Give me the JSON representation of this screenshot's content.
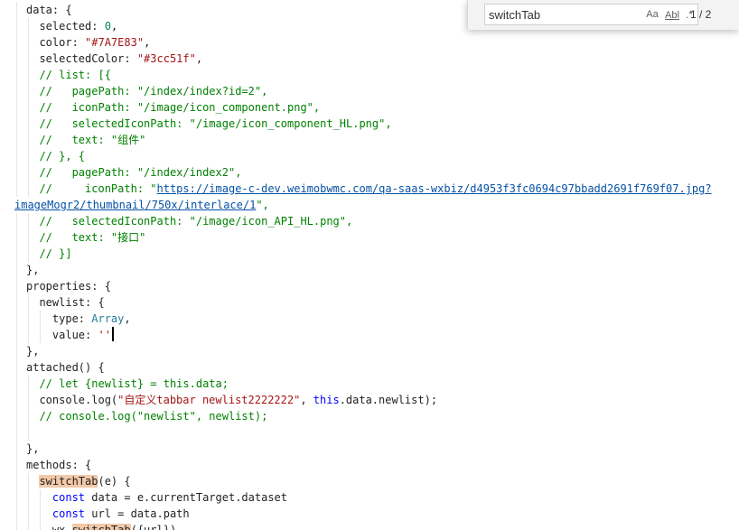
{
  "find": {
    "query": "switchTab",
    "case_label": "Aa",
    "word_label": "Abl",
    "regex_label": ".*",
    "count": "1 / 2"
  },
  "code": [
    {
      "guides": [
        18
      ],
      "segs": [
        [
          "plain",
          "data: {"
        ]
      ]
    },
    {
      "guides": [
        18,
        31
      ],
      "segs": [
        [
          "plain",
          "  selected: "
        ],
        [
          "num",
          "0"
        ],
        [
          "plain",
          ","
        ]
      ]
    },
    {
      "guides": [
        18,
        31
      ],
      "segs": [
        [
          "plain",
          "  color: "
        ],
        [
          "str",
          "\"#7A7E83\""
        ],
        [
          "plain",
          ","
        ]
      ]
    },
    {
      "guides": [
        18,
        31
      ],
      "segs": [
        [
          "plain",
          "  selectedColor: "
        ],
        [
          "str",
          "\"#3cc51f\""
        ],
        [
          "plain",
          ","
        ]
      ]
    },
    {
      "guides": [
        18,
        31
      ],
      "segs": [
        [
          "plain",
          "  "
        ],
        [
          "cmt",
          "// list: [{"
        ]
      ]
    },
    {
      "guides": [
        18,
        31
      ],
      "segs": [
        [
          "plain",
          "  "
        ],
        [
          "cmt",
          "//   pagePath: \"/index/index?id=2\","
        ]
      ]
    },
    {
      "guides": [
        18,
        31
      ],
      "segs": [
        [
          "plain",
          "  "
        ],
        [
          "cmt",
          "//   iconPath: \"/image/icon_component.png\","
        ]
      ]
    },
    {
      "guides": [
        18,
        31
      ],
      "segs": [
        [
          "plain",
          "  "
        ],
        [
          "cmt",
          "//   selectedIconPath: \"/image/icon_component_HL.png\","
        ]
      ]
    },
    {
      "guides": [
        18,
        31
      ],
      "segs": [
        [
          "plain",
          "  "
        ],
        [
          "cmt",
          "//   text: \"组件\""
        ]
      ]
    },
    {
      "guides": [
        18,
        31
      ],
      "segs": [
        [
          "plain",
          "  "
        ],
        [
          "cmt",
          "// }, {"
        ]
      ]
    },
    {
      "guides": [
        18,
        31
      ],
      "segs": [
        [
          "plain",
          "  "
        ],
        [
          "cmt",
          "//   pagePath: \"/index/index2\","
        ]
      ]
    },
    {
      "guides": [
        18,
        31
      ],
      "segs": [
        [
          "plain",
          "  "
        ],
        [
          "cmt",
          "//     iconPath: \""
        ],
        [
          "url",
          "https://image-c-dev.weimobwmc.com/qa-saas-wxbiz/d4953f3fc0694c97bbadd2691f769f07.jpg?"
        ]
      ]
    },
    {
      "guides": [],
      "segs": [
        [
          "url",
          "imageMogr2/thumbnail/750x/interlace/1"
        ],
        [
          "cmt",
          "\","
        ]
      ]
    },
    {
      "guides": [
        18,
        31
      ],
      "segs": [
        [
          "plain",
          "  "
        ],
        [
          "cmt",
          "//   selectedIconPath: \"/image/icon_API_HL.png\","
        ]
      ]
    },
    {
      "guides": [
        18,
        31
      ],
      "segs": [
        [
          "plain",
          "  "
        ],
        [
          "cmt",
          "//   text: \"接口\""
        ]
      ]
    },
    {
      "guides": [
        18,
        31
      ],
      "segs": [
        [
          "plain",
          "  "
        ],
        [
          "cmt",
          "// }]"
        ]
      ]
    },
    {
      "guides": [
        18
      ],
      "segs": [
        [
          "plain",
          "},"
        ]
      ]
    },
    {
      "guides": [
        18
      ],
      "segs": [
        [
          "plain",
          "properties: {"
        ]
      ]
    },
    {
      "guides": [
        18,
        31
      ],
      "segs": [
        [
          "plain",
          "  newlist: {"
        ]
      ]
    },
    {
      "guides": [
        18,
        31,
        44
      ],
      "segs": [
        [
          "plain",
          "    type: "
        ],
        [
          "type",
          "Array"
        ],
        [
          "plain",
          ","
        ]
      ]
    },
    {
      "guides": [
        18,
        31,
        44
      ],
      "segs": [
        [
          "plain",
          "    value: "
        ],
        [
          "str",
          "''"
        ],
        [
          "caret",
          ""
        ]
      ]
    },
    {
      "guides": [
        18
      ],
      "segs": [
        [
          "plain",
          "},"
        ]
      ]
    },
    {
      "guides": [
        18
      ],
      "segs": [
        [
          "plain",
          "attached() {"
        ]
      ]
    },
    {
      "guides": [
        18,
        31
      ],
      "segs": [
        [
          "plain",
          "  "
        ],
        [
          "cmt",
          "// let {newlist} = this.data;"
        ]
      ]
    },
    {
      "guides": [
        18,
        31
      ],
      "segs": [
        [
          "plain",
          "  console.log("
        ],
        [
          "str",
          "\"自定义tabbar newlist2222222\""
        ],
        [
          "plain",
          ", "
        ],
        [
          "kw",
          "this"
        ],
        [
          "plain",
          ".data.newlist);"
        ]
      ]
    },
    {
      "guides": [
        18,
        31
      ],
      "segs": [
        [
          "plain",
          "  "
        ],
        [
          "cmt",
          "// console.log(\"newlist\", newlist);"
        ]
      ]
    },
    {
      "guides": [
        18,
        31
      ],
      "segs": [
        [
          "plain",
          ""
        ]
      ]
    },
    {
      "guides": [
        18
      ],
      "segs": [
        [
          "plain",
          "},"
        ]
      ]
    },
    {
      "guides": [
        18
      ],
      "segs": [
        [
          "plain",
          "methods: {"
        ]
      ]
    },
    {
      "guides": [
        18,
        31
      ],
      "segs": [
        [
          "plain",
          "  "
        ],
        [
          "match",
          "switchTab"
        ],
        [
          "plain",
          "(e) {"
        ]
      ]
    },
    {
      "guides": [
        18,
        31,
        44
      ],
      "segs": [
        [
          "plain",
          "    "
        ],
        [
          "kw",
          "const"
        ],
        [
          "plain",
          " data = e.currentTarget.dataset"
        ]
      ]
    },
    {
      "guides": [
        18,
        31,
        44
      ],
      "segs": [
        [
          "plain",
          "    "
        ],
        [
          "kw",
          "const"
        ],
        [
          "plain",
          " url = data.path"
        ]
      ]
    },
    {
      "guides": [
        18,
        31,
        44
      ],
      "segs": [
        [
          "plain",
          "    wx."
        ],
        [
          "match",
          "switchTab"
        ],
        [
          "plain",
          "({url})"
        ]
      ]
    }
  ]
}
